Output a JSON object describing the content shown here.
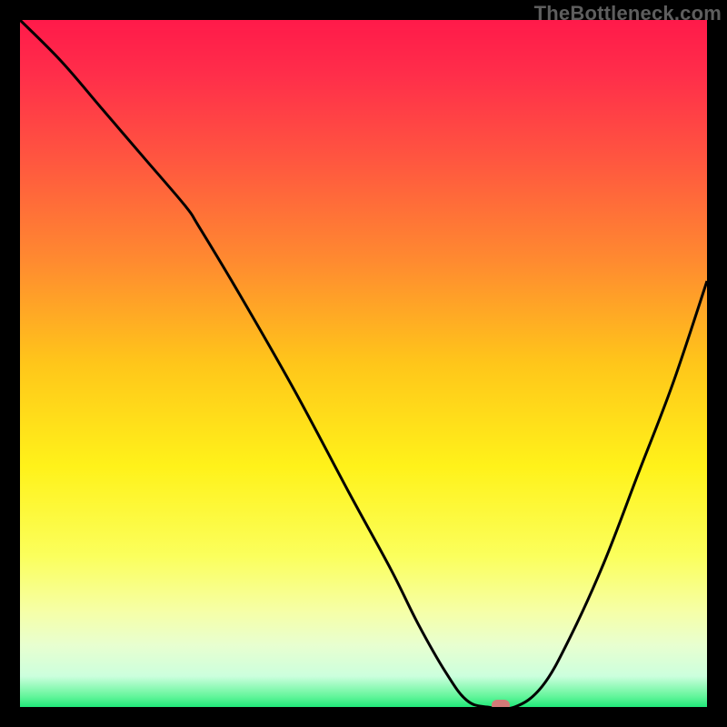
{
  "watermark": "TheBottleneck.com",
  "colors": {
    "frame": "#000000",
    "watermark": "#5e5e5e",
    "curve": "#000000",
    "marker": "#d47a78",
    "gradient_stops": [
      {
        "offset": 0.0,
        "color": "#ff1a4a"
      },
      {
        "offset": 0.08,
        "color": "#ff2e4a"
      },
      {
        "offset": 0.2,
        "color": "#ff5540"
      },
      {
        "offset": 0.35,
        "color": "#ff8a30"
      },
      {
        "offset": 0.5,
        "color": "#ffc61a"
      },
      {
        "offset": 0.65,
        "color": "#fff21a"
      },
      {
        "offset": 0.78,
        "color": "#fbff5c"
      },
      {
        "offset": 0.86,
        "color": "#f6ffa6"
      },
      {
        "offset": 0.91,
        "color": "#e8ffd0"
      },
      {
        "offset": 0.955,
        "color": "#ccffdd"
      },
      {
        "offset": 0.985,
        "color": "#62f59a"
      },
      {
        "offset": 1.0,
        "color": "#20e878"
      }
    ]
  },
  "chart_data": {
    "type": "line",
    "title": "",
    "xlabel": "",
    "ylabel": "",
    "xlim": [
      0,
      100
    ],
    "ylim": [
      0,
      100
    ],
    "grid": false,
    "legend": false,
    "series": [
      {
        "name": "bottleneck-curve",
        "x": [
          0,
          6,
          12,
          18,
          24,
          26,
          32,
          40,
          48,
          54,
          58,
          62,
          65,
          68,
          72,
          76,
          80,
          85,
          90,
          95,
          100
        ],
        "y": [
          100,
          94,
          87,
          80,
          73,
          70,
          60,
          46,
          31,
          20,
          12,
          5,
          1,
          0,
          0,
          3,
          10,
          21,
          34,
          47,
          62
        ]
      }
    ],
    "annotations": [
      {
        "name": "optimal-marker",
        "x": 70,
        "y": 0.3
      }
    ],
    "background": "vertical-gradient red→yellow→green"
  }
}
